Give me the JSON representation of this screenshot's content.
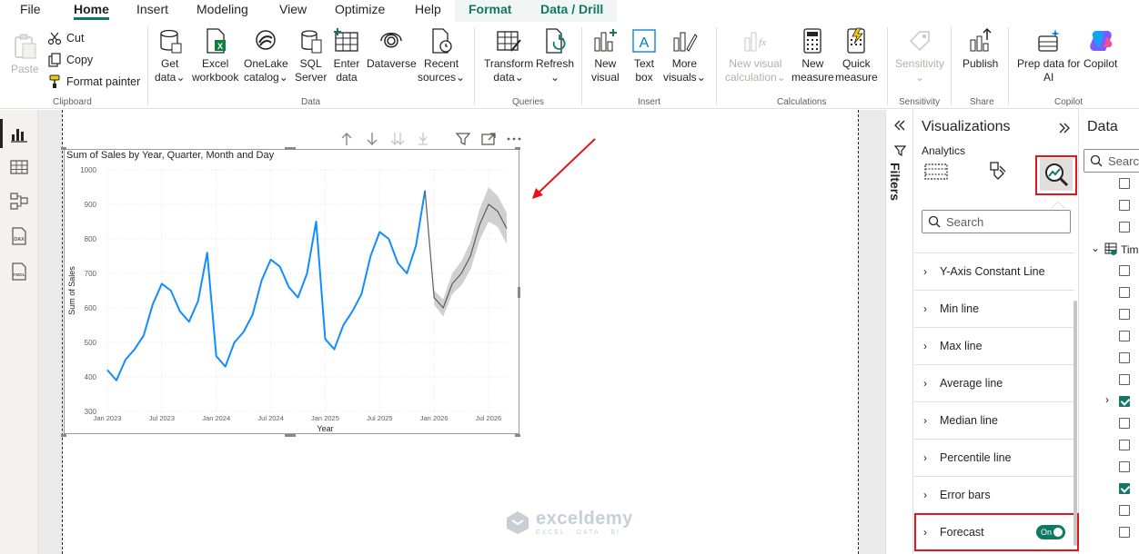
{
  "menu": {
    "items": [
      "File",
      "Home",
      "Insert",
      "Modeling",
      "View",
      "Optimize",
      "Help",
      "Format",
      "Data / Drill"
    ]
  },
  "ribbon": {
    "clipboard": {
      "paste": "Paste",
      "cut": "Cut",
      "copy": "Copy",
      "format_painter": "Format painter",
      "label": "Clipboard"
    },
    "data": {
      "get_data": [
        "Get",
        "data"
      ],
      "excel": [
        "Excel",
        "workbook"
      ],
      "onelake": [
        "OneLake",
        "catalog"
      ],
      "sql": [
        "SQL",
        "Server"
      ],
      "enter": [
        "Enter",
        "data"
      ],
      "dataverse": [
        "Dataverse",
        ""
      ],
      "recent": [
        "Recent",
        "sources"
      ],
      "label": "Data"
    },
    "queries": {
      "transform": [
        "Transform",
        "data"
      ],
      "refresh": [
        "Refresh",
        ""
      ],
      "label": "Queries"
    },
    "insert": {
      "new_visual": [
        "New",
        "visual"
      ],
      "text_box": [
        "Text",
        "box"
      ],
      "more_visuals": [
        "More",
        "visuals"
      ],
      "label": "Insert"
    },
    "calculations": {
      "new_visual_calc": [
        "New visual",
        "calculation"
      ],
      "new_measure": [
        "New",
        "measure"
      ],
      "quick_measure": [
        "Quick",
        "measure"
      ],
      "label": "Calculations"
    },
    "sensitivity": {
      "btn": [
        "Sensitivity",
        ""
      ],
      "label": "Sensitivity"
    },
    "share": {
      "publish": [
        "Publish",
        ""
      ],
      "label": "Share"
    },
    "copilot": {
      "prep": [
        "Prep data for",
        "AI"
      ],
      "copilot": [
        "Copilot",
        ""
      ],
      "label": "Copilot"
    }
  },
  "chart_data": {
    "type": "line",
    "title": "Sum of Sales by Year, Quarter, Month and Day",
    "xlabel": "Year",
    "ylabel": "Sum of Sales",
    "ylim": [
      300,
      1000
    ],
    "yticks": [
      300,
      400,
      500,
      600,
      700,
      800,
      900,
      1000
    ],
    "xticks": [
      "Jan 2023",
      "Jul 2023",
      "Jan 2024",
      "Jul 2024",
      "Jan 2025",
      "Jul 2025",
      "Jan 2026",
      "Jul 2026"
    ],
    "grid": true,
    "series": [
      {
        "color": "#118DFF",
        "x_month_index": [
          0,
          1,
          2,
          3,
          4,
          5,
          6,
          7,
          8,
          9,
          10,
          11,
          12,
          13,
          14,
          15,
          16,
          17,
          18,
          19,
          20,
          21,
          22,
          23,
          24,
          25,
          26,
          27,
          28,
          29,
          30,
          31,
          32,
          33,
          34,
          35
        ],
        "values": [
          420,
          390,
          450,
          480,
          520,
          610,
          670,
          650,
          590,
          560,
          620,
          760,
          460,
          430,
          500,
          530,
          580,
          680,
          740,
          720,
          660,
          630,
          700,
          850,
          510,
          480,
          550,
          590,
          640,
          750,
          820,
          800,
          730,
          700,
          780,
          940
        ]
      },
      {
        "color": "#5c5c5c",
        "x_month_index": [
          36,
          37,
          38,
          39,
          40,
          41,
          42,
          43,
          44
        ],
        "values": [
          630,
          600,
          670,
          700,
          750,
          840,
          900,
          880,
          830
        ],
        "forecast": true,
        "band_upper": [
          650,
          625,
          700,
          735,
          790,
          885,
          950,
          925,
          875
        ],
        "band_lower": [
          610,
          575,
          640,
          665,
          710,
          795,
          850,
          835,
          785
        ]
      }
    ]
  },
  "filters": {
    "label": "Filters"
  },
  "visualizations": {
    "title": "Visualizations",
    "subtitle": "Analytics",
    "search_placeholder": "Search",
    "items": [
      "Y-Axis Constant Line",
      "Min line",
      "Max line",
      "Average line",
      "Median line",
      "Percentile line",
      "Error bars",
      "Forecast"
    ],
    "forecast_toggle": "On"
  },
  "data_pane": {
    "title": "Data",
    "search_placeholder": "Search",
    "table_label": "Tim"
  },
  "watermark": {
    "title": "exceldemy",
    "subtitle": "EXCEL · DATA · BI"
  },
  "colors": {
    "accent": "#117865",
    "highlight": "#e3151a",
    "line": "#118DFF"
  }
}
